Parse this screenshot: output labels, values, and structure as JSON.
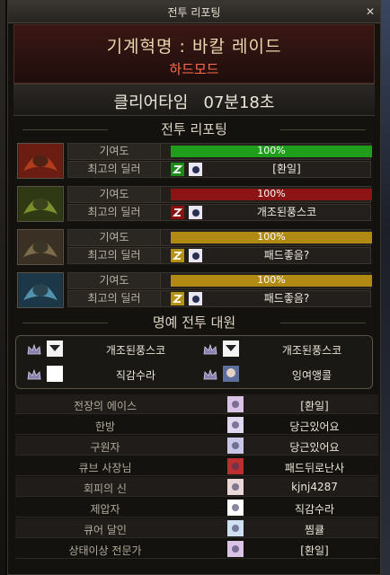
{
  "window": {
    "title": "전투 리포팅"
  },
  "raid": {
    "name": "기계혁명 : 바칼 레이드",
    "mode": "하드모드"
  },
  "clear": {
    "label": "클리어타임",
    "time": "07분18초"
  },
  "sections": {
    "report": "전투 리포팅",
    "honor": "명예 전투 대원"
  },
  "parties": [
    {
      "contrib_label": "기여도",
      "contrib_pct": 100,
      "contrib_text": "100%",
      "bar_color": "#1e9e1a",
      "best_label": "최고의 딜러",
      "dealer": "[환일]",
      "portrait_colors": [
        "#6b1d12",
        "#c0461f"
      ]
    },
    {
      "contrib_label": "기여도",
      "contrib_pct": 100,
      "contrib_text": "100%",
      "bar_color": "#8c1414",
      "best_label": "최고의 딜러",
      "dealer": "개조된풍스코",
      "portrait_colors": [
        "#2f3a14",
        "#8ea536"
      ]
    },
    {
      "contrib_label": "기여도",
      "contrib_pct": 100,
      "contrib_text": "100%",
      "bar_color": "#b08a12",
      "best_label": "최고의 딜러",
      "dealer": "패드좋음?",
      "portrait_colors": [
        "#3a3024",
        "#8c7a52"
      ]
    },
    {
      "contrib_label": "기여도",
      "contrib_pct": 100,
      "contrib_text": "100%",
      "bar_color": "#b08a12",
      "best_label": "최고의 딜러",
      "dealer": "패드좋음?",
      "portrait_colors": [
        "#1c3848",
        "#5fa9c7"
      ]
    }
  ],
  "honor_members": [
    "개조된풍스코",
    "개조된풍스코",
    "직감수라",
    "잉여앵콜"
  ],
  "awards": [
    {
      "title": "전장의 에이스",
      "name": "[환일]"
    },
    {
      "title": "한방",
      "name": "당근있어요"
    },
    {
      "title": "구원자",
      "name": "당근있어요"
    },
    {
      "title": "큐브 사장님",
      "name": "패드뒤로난사"
    },
    {
      "title": "회피의 신",
      "name": "kjnj4287"
    },
    {
      "title": "제압자",
      "name": "직감수라"
    },
    {
      "title": "큐어 달인",
      "name": "찜큘"
    },
    {
      "title": "상태이상 전문가",
      "name": "[환일]"
    }
  ]
}
